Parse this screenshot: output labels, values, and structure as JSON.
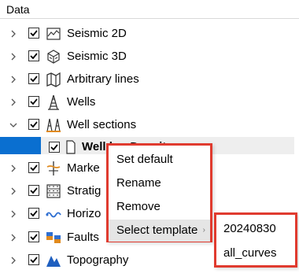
{
  "panel": {
    "title": "Data"
  },
  "tree": {
    "items": [
      {
        "label": "Seismic 2D",
        "icon": "seismic-2d-icon",
        "expander": "collapsed",
        "checked": true
      },
      {
        "label": "Seismic 3D",
        "icon": "seismic-3d-icon",
        "expander": "collapsed",
        "checked": true
      },
      {
        "label": "Arbitrary lines",
        "icon": "arbitrary-lines-icon",
        "expander": "collapsed",
        "checked": true
      },
      {
        "label": "Wells",
        "icon": "well-derrick-icon",
        "expander": "collapsed",
        "checked": true
      },
      {
        "label": "Well sections",
        "icon": "well-sections-icon",
        "expander": "expanded",
        "checked": true
      },
      {
        "label": "Well log Density",
        "icon": "document-icon",
        "expander": "none",
        "checked": true,
        "selected": true
      },
      {
        "label": "Marke",
        "icon": "markers-icon",
        "expander": "collapsed",
        "checked": true
      },
      {
        "label": "Stratig",
        "icon": "stratigraphy-icon",
        "expander": "collapsed",
        "checked": true
      },
      {
        "label": "Horizo",
        "icon": "horizons-icon",
        "expander": "collapsed",
        "checked": true
      },
      {
        "label": "Faults",
        "icon": "faults-icon",
        "expander": "collapsed",
        "checked": true
      },
      {
        "label": "Topography",
        "icon": "topography-icon",
        "expander": "collapsed",
        "checked": true
      }
    ]
  },
  "context_menu": {
    "items": [
      "Set default",
      "Rename",
      "Remove",
      "Select template"
    ],
    "submenu_arrow": "›"
  },
  "submenu": {
    "items": [
      "20240830",
      "all_curves"
    ]
  },
  "colors": {
    "highlight_border": "#e03b2f",
    "selection_blue": "#0a6fd0"
  }
}
